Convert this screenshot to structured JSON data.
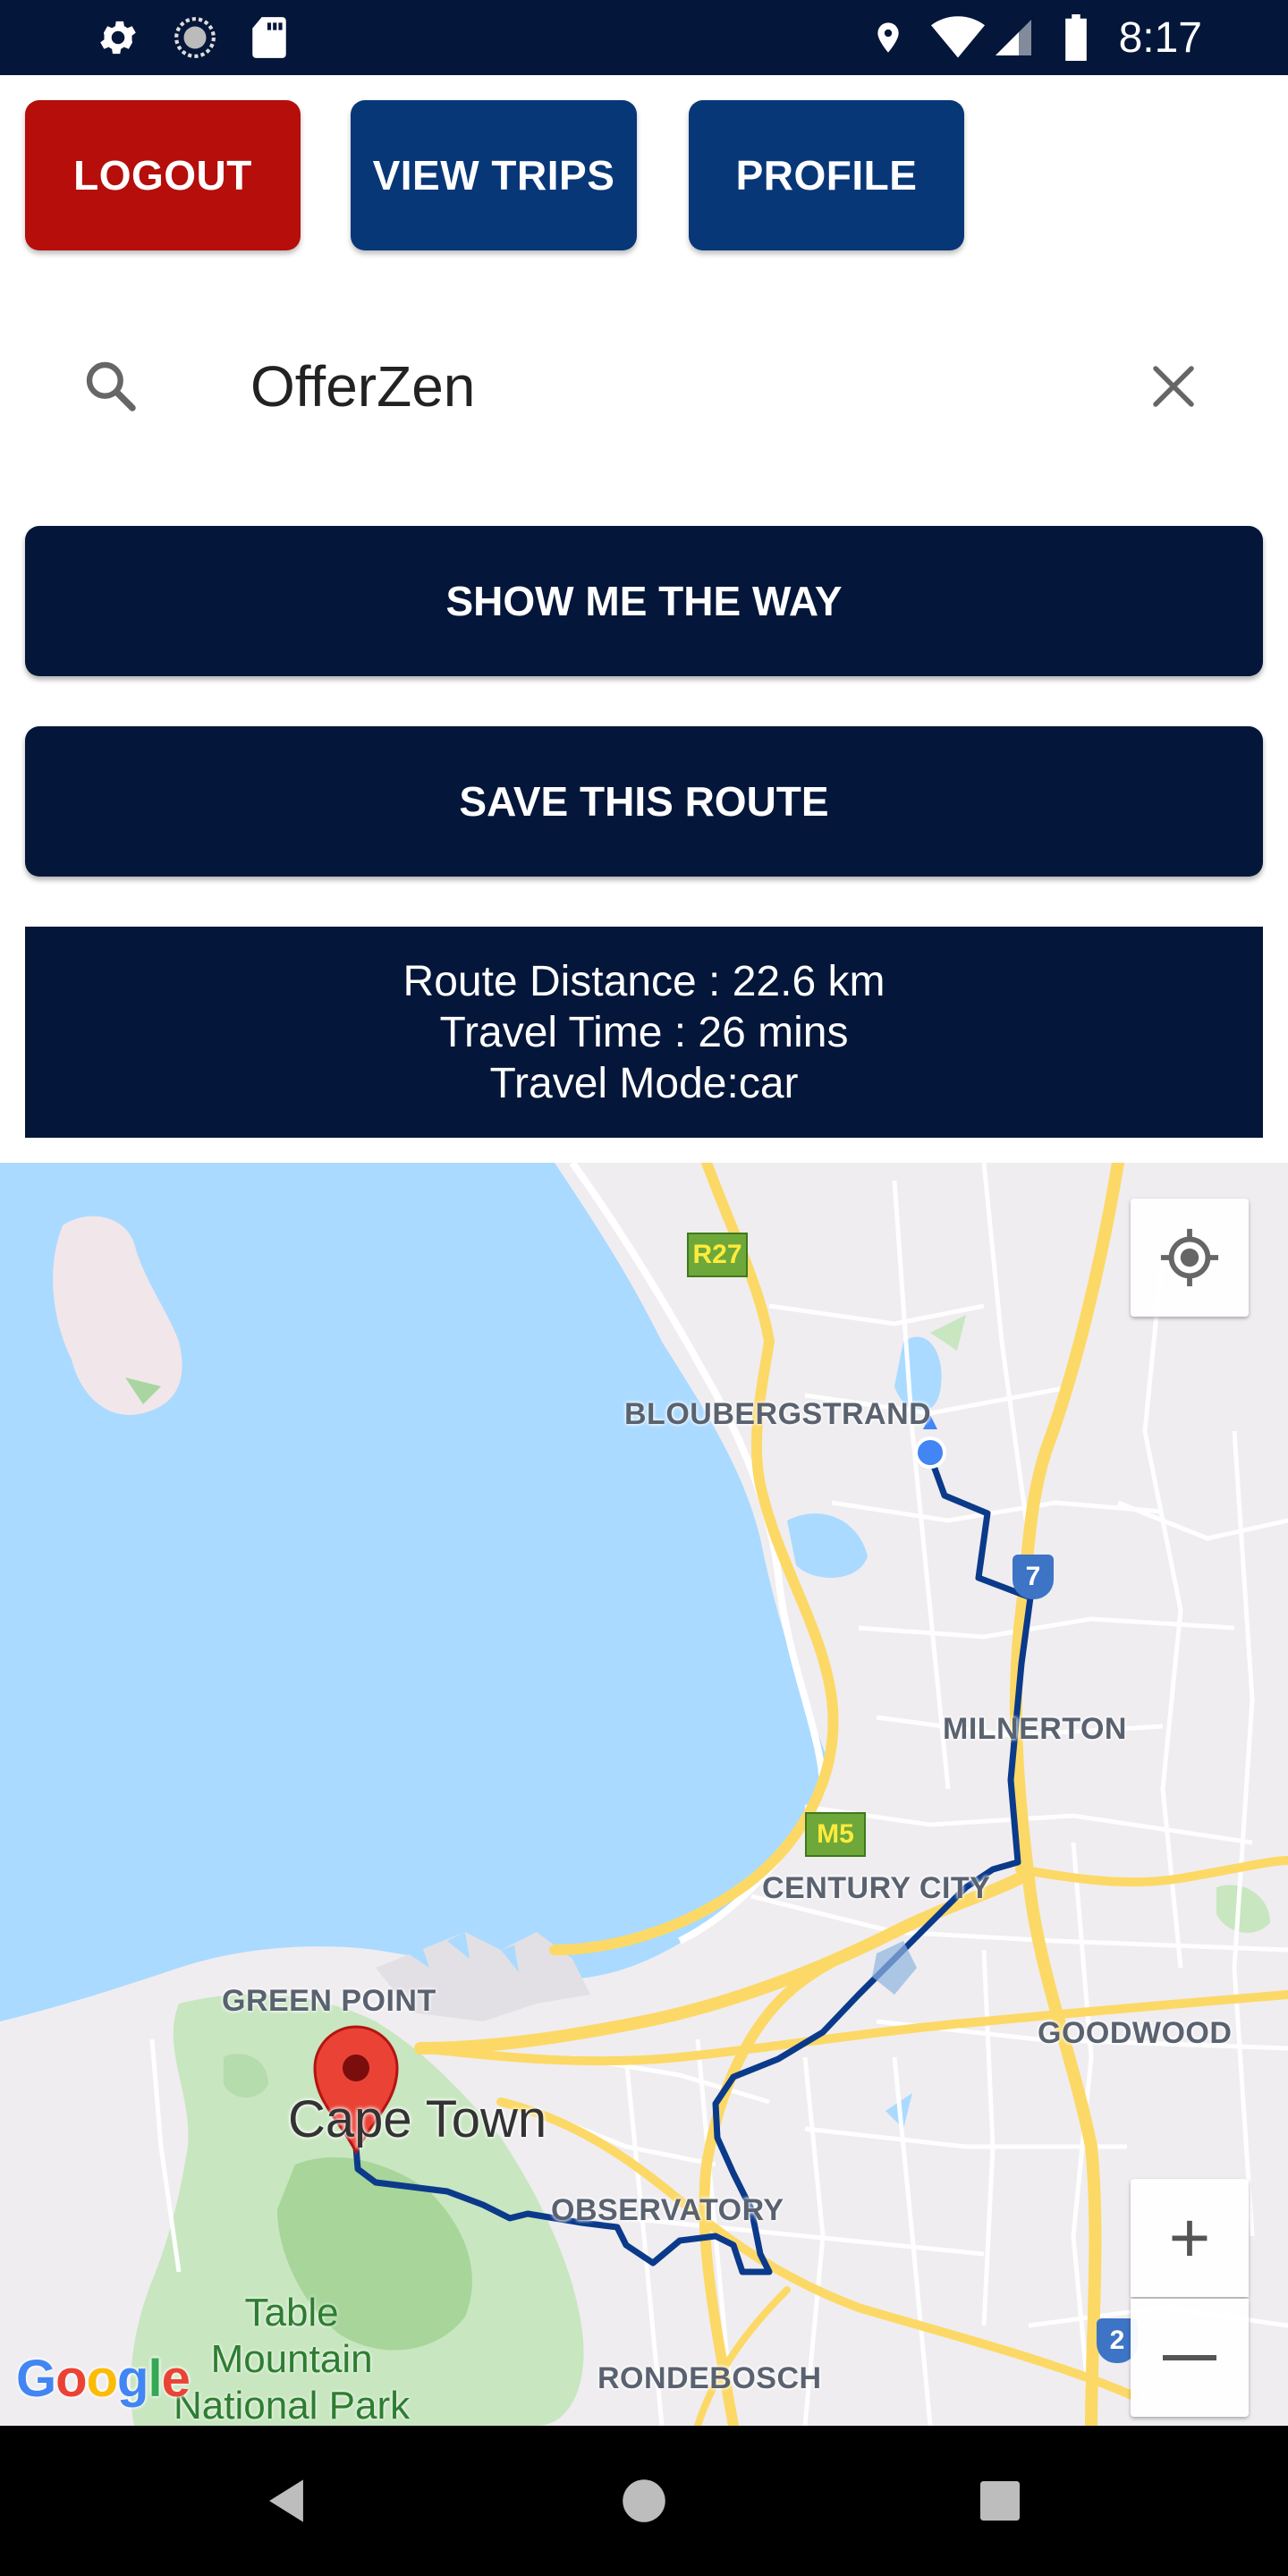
{
  "status_bar": {
    "time": "8:17",
    "left_icons": [
      "gear-icon",
      "sync-icon",
      "sd-card-icon"
    ],
    "right_icons": [
      "location-icon",
      "wifi-icon",
      "signal-icon",
      "battery-icon"
    ]
  },
  "top_buttons": {
    "logout": "LOGOUT",
    "view_trips": "VIEW TRIPS",
    "profile": "PROFILE",
    "colors": {
      "logout": "#b50e0b",
      "primary": "#083778"
    }
  },
  "search": {
    "value": "OfferZen"
  },
  "actions": {
    "show_way": "SHOW ME THE WAY",
    "save_route": "SAVE THIS ROUTE"
  },
  "route_info": {
    "distance": "Route Distance : 22.6 km",
    "time": "Travel Time : 26 mins",
    "mode": "Travel Mode:car"
  },
  "map": {
    "labels": {
      "bloubergstrand": "BLOUBERGSTRAND",
      "milnerton": "MILNERTON",
      "century_city": "CENTURY CITY",
      "green_point": "GREEN POINT",
      "goodwood": "GOODWOOD",
      "observatory": "OBSERVATORY",
      "rondebosch": "RONDEBOSCH",
      "cape_town": "Cape Town",
      "park_line1": "Table",
      "park_line2": "Mountain",
      "park_line3": "National Park"
    },
    "shields": {
      "r27": "R27",
      "m5": "M5",
      "n7": "7",
      "n2": "2"
    },
    "zoom_in": "+",
    "google": [
      "G",
      "o",
      "o",
      "g",
      "l",
      "e"
    ],
    "route_color": "#0b3a8a",
    "water_color": "#aadaff"
  }
}
